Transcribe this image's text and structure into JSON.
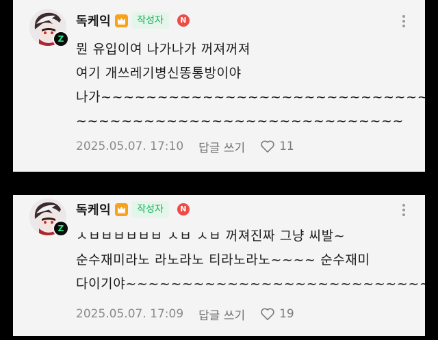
{
  "comments": [
    {
      "nickname": "독케익",
      "author_badge": "작성자",
      "n_badge": "N",
      "lines": [
        "뭔 유입이여 나가나가 꺼져꺼져",
        "여기 개쓰레기병신똥통방이야",
        "나가~~~~~~~~~~~~~~~~~~~~~~~~~~~~~~~~",
        "~~~~~~~~~~~~~~~~~~~~~~~~~~~~~"
      ],
      "timestamp": "2025.05.07. 17:10",
      "reply_label": "답글 쓰기",
      "likes": "11",
      "avatar_badge": "Z"
    },
    {
      "nickname": "독케익",
      "author_badge": "작성자",
      "n_badge": "N",
      "lines": [
        "ㅅㅂㅂㅂㅂㅂㅂ ㅅㅂ ㅅㅂ 꺼져진짜 그냥 씨발~",
        "순수재미라노 라노라노 티라노라노~~~~ 순수재미",
        "다이기야~~~~~~~~~~~~~~~~~~~~~~~~~~~~~~"
      ],
      "timestamp": "2025.05.07. 17:09",
      "reply_label": "답글 쓰기",
      "likes": "19",
      "avatar_badge": "Z"
    }
  ],
  "icons": {
    "crown": "crown-icon",
    "more": "more-vertical-icon",
    "like": "heart-outline-icon"
  },
  "colors": {
    "card_bg": "#f4f4f4",
    "author_badge_text": "#19b35d",
    "author_badge_bg": "#e4f5ea",
    "crown": "#f7a21c",
    "n_badge": "#ec4b46"
  }
}
